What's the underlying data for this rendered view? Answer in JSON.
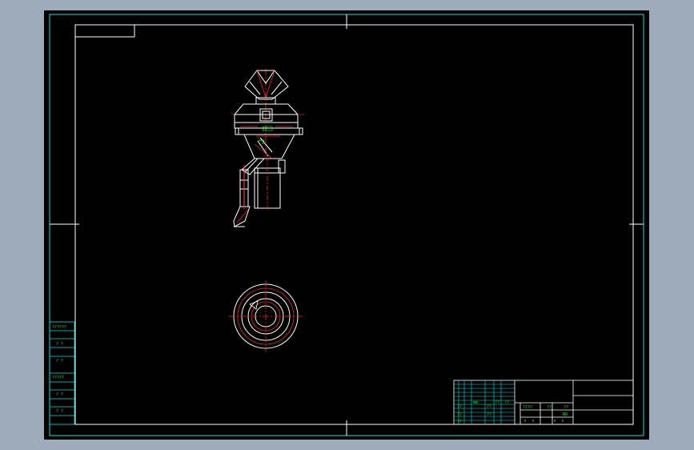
{
  "app": {
    "type": "CAD drawing viewport",
    "background_color": "#000000",
    "frame_color": "#00e5e5",
    "geometry_color": "#ffffff",
    "centerline_color": "#ff2020",
    "annotation_color": "#00ff00"
  },
  "side_strip": {
    "labels": [
      "??????",
      "? ?",
      "? ?",
      "?????",
      "? ?",
      "? ?"
    ]
  },
  "title_block": {
    "cells": {
      "c1": "mm",
      "c2": "??",
      "c3": "??",
      "c4": "??",
      "c5": "??",
      "c6": "??",
      "c7": "??",
      "c8": "??",
      "c9": "????",
      "c10": "??",
      "c11": "??",
      "c12": "NO"
    }
  },
  "drawing": {
    "front_view_label": "??"
  }
}
